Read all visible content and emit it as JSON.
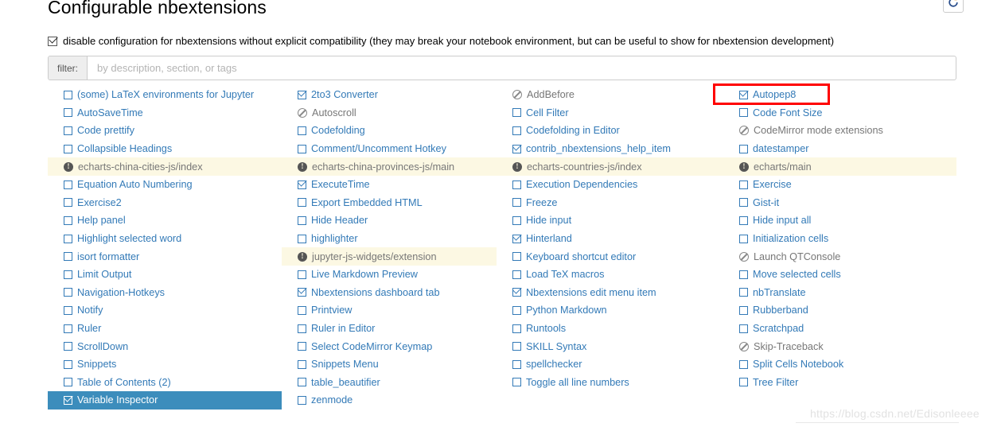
{
  "header": {
    "title": "Configurable nbextensions",
    "refresh_icon": "refresh-icon"
  },
  "disable_config": {
    "checked": true,
    "label": "disable configuration for nbextensions without explicit compatibility (they may break your notebook environment, but can be useful to show for nbextension development)"
  },
  "filter": {
    "label": "filter:",
    "value": "",
    "placeholder": "by description, section, or tags"
  },
  "annotation": {
    "target": "Autopep8",
    "color": "#ff0000"
  },
  "colors": {
    "link": "#337ab7",
    "selected_bg": "#3c8dbc",
    "warn_bg": "#fcf8e3",
    "muted": "#777777"
  },
  "watermark": "https://blog.csdn.net/Edisonleeee",
  "extensions": {
    "columns": 4,
    "rows": [
      [
        {
          "label": "(some) LaTeX environments for Jupyter",
          "state": "unchecked"
        },
        {
          "label": "2to3 Converter",
          "state": "checked"
        },
        {
          "label": "AddBefore",
          "state": "incompatible"
        },
        {
          "label": "Autopep8",
          "state": "checked",
          "annotated": true
        }
      ],
      [
        {
          "label": "AutoSaveTime",
          "state": "unchecked"
        },
        {
          "label": "Autoscroll",
          "state": "incompatible"
        },
        {
          "label": "Cell Filter",
          "state": "unchecked"
        },
        {
          "label": "Code Font Size",
          "state": "unchecked"
        }
      ],
      [
        {
          "label": "Code prettify",
          "state": "unchecked"
        },
        {
          "label": "Codefolding",
          "state": "unchecked"
        },
        {
          "label": "Codefolding in Editor",
          "state": "unchecked"
        },
        {
          "label": "CodeMirror mode extensions",
          "state": "incompatible"
        }
      ],
      [
        {
          "label": "Collapsible Headings",
          "state": "unchecked"
        },
        {
          "label": "Comment/Uncomment Hotkey",
          "state": "unchecked"
        },
        {
          "label": "contrib_nbextensions_help_item",
          "state": "checked"
        },
        {
          "label": "datestamper",
          "state": "unchecked"
        }
      ],
      [
        {
          "label": "echarts-china-cities-js/index",
          "state": "warning"
        },
        {
          "label": "echarts-china-provinces-js/main",
          "state": "warning"
        },
        {
          "label": "echarts-countries-js/index",
          "state": "warning"
        },
        {
          "label": "echarts/main",
          "state": "warning"
        }
      ],
      [
        {
          "label": "Equation Auto Numbering",
          "state": "unchecked"
        },
        {
          "label": "ExecuteTime",
          "state": "checked"
        },
        {
          "label": "Execution Dependencies",
          "state": "unchecked"
        },
        {
          "label": "Exercise",
          "state": "unchecked"
        }
      ],
      [
        {
          "label": "Exercise2",
          "state": "unchecked"
        },
        {
          "label": "Export Embedded HTML",
          "state": "unchecked"
        },
        {
          "label": "Freeze",
          "state": "unchecked"
        },
        {
          "label": "Gist-it",
          "state": "unchecked"
        }
      ],
      [
        {
          "label": "Help panel",
          "state": "unchecked"
        },
        {
          "label": "Hide Header",
          "state": "unchecked"
        },
        {
          "label": "Hide input",
          "state": "unchecked"
        },
        {
          "label": "Hide input all",
          "state": "unchecked"
        }
      ],
      [
        {
          "label": "Highlight selected word",
          "state": "unchecked"
        },
        {
          "label": "highlighter",
          "state": "unchecked"
        },
        {
          "label": "Hinterland",
          "state": "checked"
        },
        {
          "label": "Initialization cells",
          "state": "unchecked"
        }
      ],
      [
        {
          "label": "isort formatter",
          "state": "unchecked"
        },
        {
          "label": "jupyter-js-widgets/extension",
          "state": "warning"
        },
        {
          "label": "Keyboard shortcut editor",
          "state": "unchecked"
        },
        {
          "label": "Launch QTConsole",
          "state": "incompatible"
        }
      ],
      [
        {
          "label": "Limit Output",
          "state": "unchecked"
        },
        {
          "label": "Live Markdown Preview",
          "state": "unchecked"
        },
        {
          "label": "Load TeX macros",
          "state": "unchecked"
        },
        {
          "label": "Move selected cells",
          "state": "unchecked"
        }
      ],
      [
        {
          "label": "Navigation-Hotkeys",
          "state": "unchecked"
        },
        {
          "label": "Nbextensions dashboard tab",
          "state": "checked"
        },
        {
          "label": "Nbextensions edit menu item",
          "state": "checked"
        },
        {
          "label": "nbTranslate",
          "state": "unchecked"
        }
      ],
      [
        {
          "label": "Notify",
          "state": "unchecked"
        },
        {
          "label": "Printview",
          "state": "unchecked"
        },
        {
          "label": "Python Markdown",
          "state": "unchecked"
        },
        {
          "label": "Rubberband",
          "state": "unchecked"
        }
      ],
      [
        {
          "label": "Ruler",
          "state": "unchecked"
        },
        {
          "label": "Ruler in Editor",
          "state": "unchecked"
        },
        {
          "label": "Runtools",
          "state": "unchecked"
        },
        {
          "label": "Scratchpad",
          "state": "unchecked"
        }
      ],
      [
        {
          "label": "ScrollDown",
          "state": "unchecked"
        },
        {
          "label": "Select CodeMirror Keymap",
          "state": "unchecked"
        },
        {
          "label": "SKILL Syntax",
          "state": "unchecked"
        },
        {
          "label": "Skip-Traceback",
          "state": "incompatible"
        }
      ],
      [
        {
          "label": "Snippets",
          "state": "unchecked"
        },
        {
          "label": "Snippets Menu",
          "state": "unchecked"
        },
        {
          "label": "spellchecker",
          "state": "unchecked"
        },
        {
          "label": "Split Cells Notebook",
          "state": "unchecked"
        }
      ],
      [
        {
          "label": "Table of Contents (2)",
          "state": "unchecked"
        },
        {
          "label": "table_beautifier",
          "state": "unchecked"
        },
        {
          "label": "Toggle all line numbers",
          "state": "unchecked"
        },
        {
          "label": "Tree Filter",
          "state": "unchecked"
        }
      ],
      [
        {
          "label": "Variable Inspector",
          "state": "checked",
          "selected": true
        },
        {
          "label": "zenmode",
          "state": "unchecked"
        },
        {
          "label": "",
          "state": "empty"
        },
        {
          "label": "",
          "state": "empty"
        }
      ]
    ]
  }
}
